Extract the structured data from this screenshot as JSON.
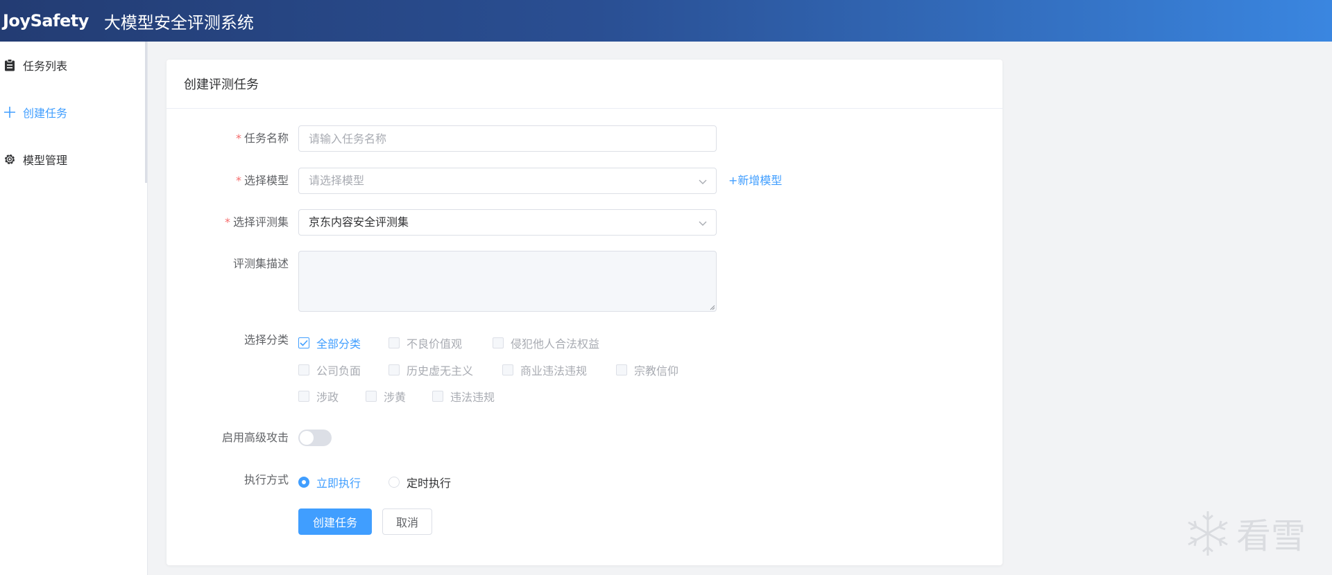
{
  "header": {
    "logo": "JoySafety",
    "title": "大模型安全评测系统"
  },
  "sidebar": {
    "items": [
      {
        "label": "任务列表",
        "icon": "clipboard-icon",
        "active": false
      },
      {
        "label": "创建任务",
        "icon": "plus-icon",
        "active": true
      },
      {
        "label": "模型管理",
        "icon": "gear-icon",
        "active": false
      }
    ]
  },
  "form": {
    "title": "创建评测任务",
    "required_mark": "*",
    "task_name": {
      "label": "任务名称",
      "placeholder": "请输入任务名称",
      "value": ""
    },
    "model": {
      "label": "选择模型",
      "placeholder": "请选择模型",
      "add_label": "+新增模型"
    },
    "eval_set": {
      "label": "选择评测集",
      "value": "京东内容安全评测集"
    },
    "eval_desc": {
      "label": "评测集描述",
      "value": ""
    },
    "category": {
      "label": "选择分类",
      "options": [
        {
          "label": "全部分类",
          "checked": true
        },
        {
          "label": "不良价值观",
          "checked": false
        },
        {
          "label": "侵犯他人合法权益",
          "checked": false
        },
        {
          "label": "公司负面",
          "checked": false
        },
        {
          "label": "历史虚无主义",
          "checked": false
        },
        {
          "label": "商业违法违规",
          "checked": false
        },
        {
          "label": "宗教信仰",
          "checked": false
        },
        {
          "label": "涉政",
          "checked": false
        },
        {
          "label": "涉黄",
          "checked": false
        },
        {
          "label": "违法违规",
          "checked": false
        }
      ]
    },
    "advanced_attack": {
      "label": "启用高级攻击",
      "enabled": false
    },
    "exec_mode": {
      "label": "执行方式",
      "options": [
        {
          "label": "立即执行",
          "checked": true
        },
        {
          "label": "定时执行",
          "checked": false
        }
      ]
    },
    "submit_label": "创建任务",
    "cancel_label": "取消"
  },
  "watermark": {
    "text": "看雪",
    "icon": "snowflake-icon"
  },
  "colors": {
    "accent": "#409eff",
    "required": "#f56c6c",
    "header_start": "#233c73",
    "header_end": "#3a86e0"
  }
}
